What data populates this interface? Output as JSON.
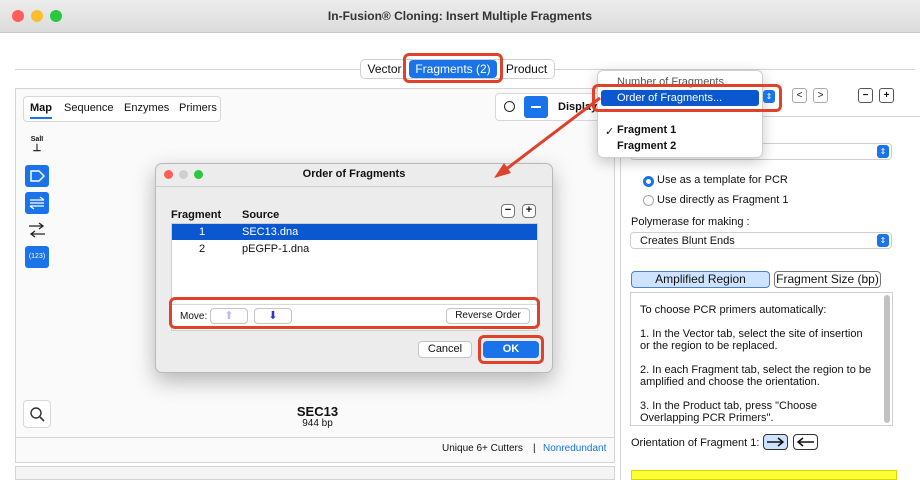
{
  "window": {
    "title": "In-Fusion® Cloning: Insert Multiple Fragments"
  },
  "main_tabs": [
    {
      "label": "Vector"
    },
    {
      "label": "Fragments (2)"
    },
    {
      "label": "Product"
    }
  ],
  "left": {
    "subtabs": [
      "Map",
      "Sequence",
      "Enzymes",
      "Primers"
    ],
    "tools": {
      "sall_label": "SalI",
      "count_label": "(123)"
    },
    "display_label": "Display",
    "sequence_name": "SEC13",
    "sequence_length": "944 bp",
    "footer": {
      "cutters": "Unique 6+ Cutters",
      "separator": "|",
      "nonredundant": "Nonredundant"
    }
  },
  "dialog": {
    "title": "Order of Fragments",
    "columns": [
      "Fragment",
      "Source"
    ],
    "rows": [
      {
        "fragment": "1",
        "source": "SEC13.dna"
      },
      {
        "fragment": "2",
        "source": "pEGFP-1.dna"
      }
    ],
    "move_label": "Move:",
    "reverse_label": "Reverse Order",
    "cancel_label": "Cancel",
    "ok_label": "OK"
  },
  "popup": {
    "items": [
      "Number of Fragments",
      "Order of Fragments..."
    ],
    "fragments": [
      "Fragment 1",
      "Fragment 2"
    ],
    "checkmark": "✓"
  },
  "right": {
    "radio_template": "Use as a template for PCR",
    "radio_direct": "Use directly as Fragment 1",
    "polymerase_label": "Polymerase for making :",
    "polymerase_value": "Creates Blunt Ends",
    "tab_amplified": "Amplified Region",
    "tab_fragment_size": "Fragment Size (bp)",
    "instructions": [
      "To choose PCR primers automatically:",
      "1. In the Vector tab, select the site of insertion or the region to be replaced.",
      "2. In each Fragment tab, select the region to be amplified and choose the orientation.",
      "3. In the Product tab, press \"Choose Overlapping PCR Primers\"."
    ],
    "orientation_label": "Orientation of Fragment 1:"
  },
  "colors": {
    "accent": "#1a73e8",
    "annotation": "#e0412a",
    "selection": "#0b57d0",
    "note": "#ffff3a"
  }
}
